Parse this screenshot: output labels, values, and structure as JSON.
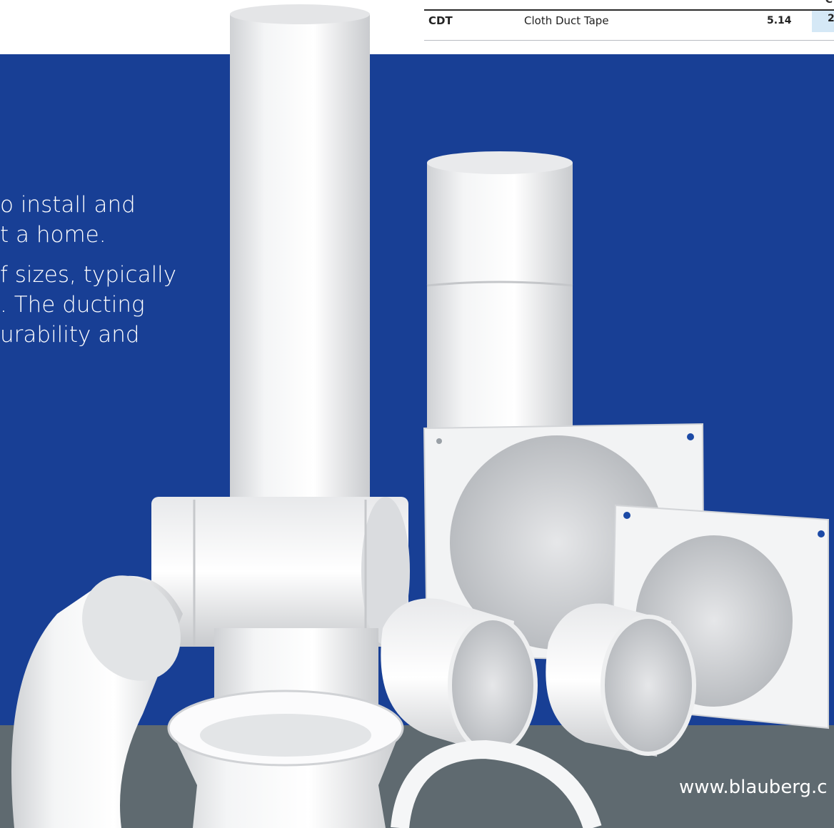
{
  "table": {
    "header_fragment": "C",
    "row": {
      "code": "CDT",
      "description": "Cloth Duct Tape",
      "value": "5.14",
      "value2": "2"
    }
  },
  "intro": {
    "line1": "o install and",
    "line2": "t a home.",
    "line3": "f sizes, typically",
    "line4": ". The ducting",
    "line5": "urability and"
  },
  "footer": {
    "url": "www.blauberg.c"
  },
  "colors": {
    "brand_blue": "#183f95",
    "band_grey": "#5f6a70",
    "cell_highlight": "#d5e8f6"
  }
}
